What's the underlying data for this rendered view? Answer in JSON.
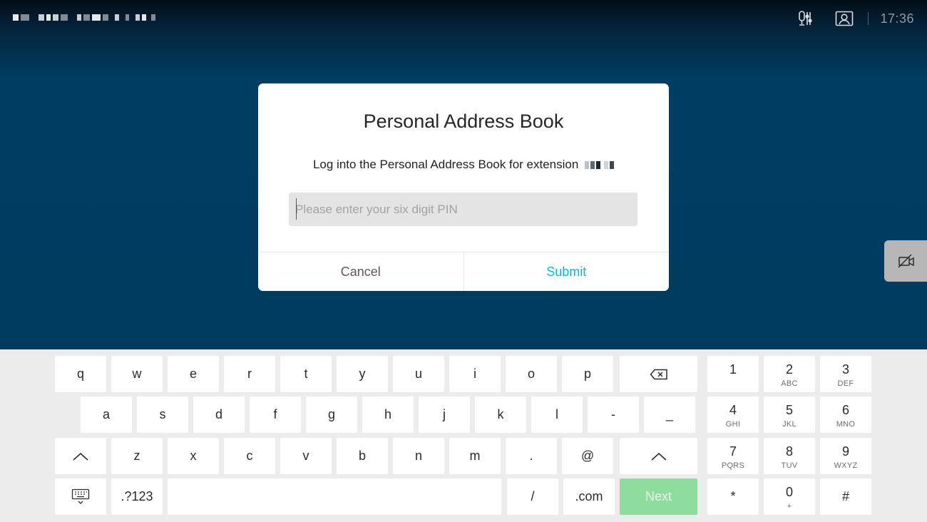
{
  "top_bar": {
    "site_name": "redacted",
    "clock": "17:36",
    "icons": [
      "microphone-adjust-icon",
      "contact-card-icon"
    ]
  },
  "dialog": {
    "title": "Personal Address Book",
    "message": "Log into the Personal Address Book for extension",
    "extension": "redacted",
    "pin_input": {
      "value": "",
      "placeholder": "Please enter your six digit PIN"
    },
    "cancel_label": "Cancel",
    "submit_label": "Submit"
  },
  "side_toggle": {
    "icon": "camera-off-icon"
  },
  "keyboard": {
    "row1": [
      "q",
      "w",
      "e",
      "r",
      "t",
      "y",
      "u",
      "i",
      "o",
      "p"
    ],
    "row2": [
      "a",
      "s",
      "d",
      "f",
      "g",
      "h",
      "j",
      "k",
      "l",
      "-",
      "_"
    ],
    "row3": [
      "z",
      "x",
      "c",
      "v",
      "b",
      "n",
      "m",
      ".",
      "@"
    ],
    "symbols_label": ".?123",
    "slash_label": "/",
    "dotcom_label": ".com",
    "next_label": "Next",
    "backspace_icon": "backspace-icon",
    "shift_icon": "shift-icon",
    "hide_keyboard_icon": "keyboard-hide-icon",
    "numpad": [
      {
        "digit": "1",
        "letters": ""
      },
      {
        "digit": "2",
        "letters": "ABC"
      },
      {
        "digit": "3",
        "letters": "DEF"
      },
      {
        "digit": "4",
        "letters": "GHI"
      },
      {
        "digit": "5",
        "letters": "JKL"
      },
      {
        "digit": "6",
        "letters": "MNO"
      },
      {
        "digit": "7",
        "letters": "PQRS"
      },
      {
        "digit": "8",
        "letters": "TUV"
      },
      {
        "digit": "9",
        "letters": "WXYZ"
      },
      {
        "digit": "*",
        "letters": ""
      },
      {
        "digit": "0",
        "letters": "+"
      },
      {
        "digit": "#",
        "letters": ""
      }
    ]
  },
  "colors": {
    "background": "#003c60",
    "submit_text": "#14b4d8",
    "next_key": "#8fdc9f",
    "keyboard_bg": "#ececec"
  }
}
